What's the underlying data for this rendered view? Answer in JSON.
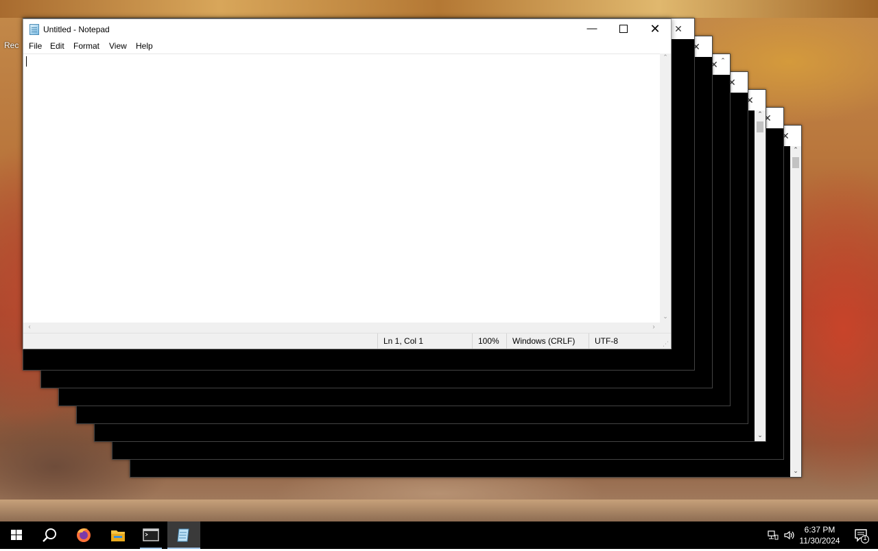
{
  "desktop": {
    "recycle_label": "Rec"
  },
  "background_windows": {
    "close_glyph": "✕",
    "min_glyph": "—",
    "max_glyph": "☐",
    "scroll_up": "⌃",
    "scroll_down": "⌄"
  },
  "notepad": {
    "title": "Untitled - Notepad",
    "controls": {
      "minimize": "—",
      "close": "✕"
    },
    "menu": [
      "File",
      "Edit",
      "Format",
      "View",
      "Help"
    ],
    "content": "",
    "scroll": {
      "up": "⌃",
      "down": "⌄",
      "left": "‹",
      "right": "›"
    },
    "status": {
      "position": "Ln 1, Col 1",
      "zoom": "100%",
      "line_endings": "Windows (CRLF)",
      "encoding": "UTF-8",
      "grip": "⋰"
    }
  },
  "taskbar": {
    "clock_time": "6:37 PM",
    "clock_date": "11/30/2024",
    "notification_count": "1",
    "apps": [
      "start-icon",
      "search-icon",
      "firefox-icon",
      "file-explorer-icon",
      "terminal-icon",
      "notepad-icon"
    ],
    "tray": [
      "network-icon",
      "volume-icon",
      "notification-icon"
    ]
  }
}
